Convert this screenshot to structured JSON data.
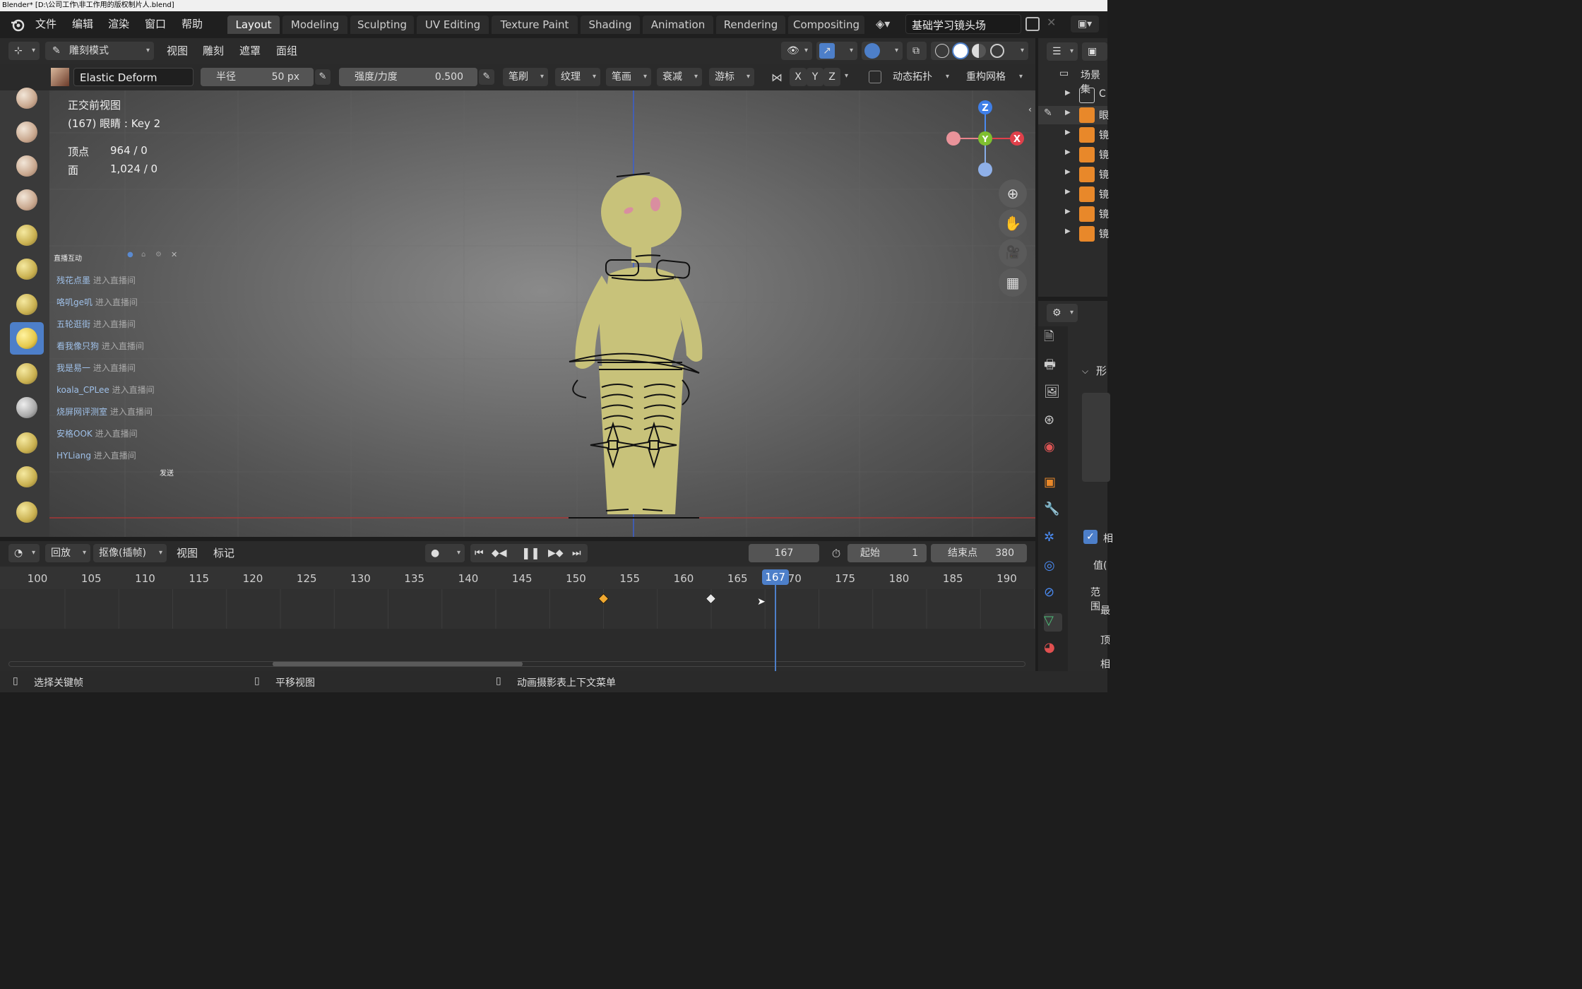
{
  "titlebar": {
    "text": "Blender* [D:\\公司工作\\非工作用的版权制片人.blend]"
  },
  "menu": {
    "file": "文件",
    "edit": "编辑",
    "render": "渲染",
    "window": "窗口",
    "help": "帮助"
  },
  "workspaces": [
    {
      "label": "Layout",
      "active": true
    },
    {
      "label": "Modeling"
    },
    {
      "label": "Sculpting"
    },
    {
      "label": "UV Editing"
    },
    {
      "label": "Texture Paint"
    },
    {
      "label": "Shading"
    },
    {
      "label": "Animation"
    },
    {
      "label": "Rendering"
    },
    {
      "label": "Compositing"
    }
  ],
  "scene": {
    "name": "基础学习镜头场"
  },
  "header": {
    "mode": "雕刻模式",
    "view": "视图",
    "sculpt": "雕刻",
    "mask": "遮罩",
    "face_sets": "面组"
  },
  "tool_settings": {
    "brush_name": "Elastic Deform",
    "radius_label": "半径",
    "radius_value": "50 px",
    "strength_label": "强度/力度",
    "strength_value": "0.500",
    "brush": "笔刷",
    "texture": "纹理",
    "stroke": "笔画",
    "falloff": "衰减",
    "cursor": "游标",
    "x": "X",
    "y": "Y",
    "z": "Z",
    "dyntopo": "动态拓扑",
    "remesh": "重构网格"
  },
  "viewport_overlay": {
    "view_name": "正交前视图",
    "object_info": "(167) 眼睛 : Key 2",
    "vertices_label": "顶点",
    "vertices_value": "964 / 0",
    "faces_label": "面",
    "faces_value": "1,024 / 0"
  },
  "gizmo": {
    "z": "Z",
    "y": "Y",
    "x": "X"
  },
  "live_chat": {
    "title": "直播互动",
    "send": "发送",
    "entries": [
      {
        "user": "残花点墨",
        "action": "进入直播间"
      },
      {
        "user": "咯叽ge叽",
        "action": "进入直播间"
      },
      {
        "user": "五轮逛街",
        "action": "进入直播间"
      },
      {
        "user": "看我像只狗",
        "action": "进入直播间"
      },
      {
        "user": "我是易一",
        "action": "进入直播间"
      },
      {
        "user": "koala_CPLee",
        "action": "进入直播间"
      },
      {
        "user": "烧屏网评测室",
        "action": "进入直播间"
      },
      {
        "user": "安格OOK",
        "action": "进入直播间"
      },
      {
        "user": "HYLiang",
        "action": "进入直播间"
      }
    ]
  },
  "timeline": {
    "playback": "回放",
    "keying": "抠像(插帧)",
    "view": "视图",
    "marker": "标记",
    "current_frame": "167",
    "start_label": "起始",
    "start_value": "1",
    "end_label": "结束点",
    "end_value": "380",
    "ticks": [
      "100",
      "105",
      "110",
      "115",
      "120",
      "125",
      "130",
      "135",
      "140",
      "145",
      "150",
      "155",
      "160",
      "165",
      "170",
      "175",
      "180",
      "185",
      "190"
    ],
    "playhead": "167",
    "keyframes": [
      {
        "frame": 150,
        "selected": true,
        "color": "#f0a830"
      },
      {
        "frame": 160,
        "selected": false,
        "color": "#e8e8e8"
      }
    ]
  },
  "outliner": {
    "title": "场景集",
    "items": [
      "C",
      "眼",
      "镜",
      "镜",
      "镜",
      "镜",
      "镜",
      "镜"
    ]
  },
  "properties": {
    "shape_keys_label": "形",
    "value_label": "值(",
    "range_label": "范围",
    "min_label": "最",
    "vertex_label": "顶",
    "rel_label": "相"
  },
  "status": {
    "select_keyframe": "选择关键帧",
    "pan_view": "平移视图",
    "context_menu": "动画摄影表上下文菜单"
  },
  "colors": {
    "accent": "#4d7fc9",
    "figure": "#c8c27a",
    "keyframe_selected": "#f0a830"
  }
}
